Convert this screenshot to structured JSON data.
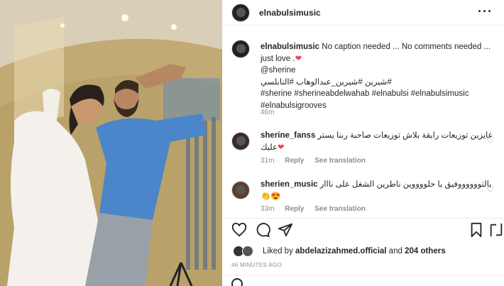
{
  "post": {
    "username": "elnabulsimusic",
    "more_icon": "more-horizontal-icon"
  },
  "caption": {
    "username": "elnabulsimusic",
    "text_line1": " No caption needed ... No comments needed ... just love .",
    "heart": "❤",
    "mention": "@sherine",
    "hashtags_ar": "#شيرين #شيرين_عبدالوهاب #النابلسي",
    "hashtags_en1": "#sherine #sherineabdelwahab #elnabulsi #elnabulsimusic",
    "hashtags_en2": "#elnabulsigrooves",
    "time": "46m"
  },
  "comments": [
    {
      "username": "sherine_fanss",
      "text": "عايزين توزيعات رايقة بلاش توزيعات صاحبة ربنا يستر عليك",
      "heart": "❤",
      "time": "31m",
      "reply": "Reply",
      "translate": "See translation"
    },
    {
      "username": "sherien_music",
      "text": "بالتووووووفيق يا حلووووين ناطرين الشغل على نااار",
      "emojis": "👏😍",
      "time": "33m",
      "reply": "Reply",
      "translate": "See translation"
    }
  ],
  "likes": {
    "prefix": "Liked by ",
    "user": "abdelazizahmed.official",
    "middle": " and ",
    "others": "204 others"
  },
  "timestamp": "46 MINUTES AGO",
  "colors": {
    "heart": "#ed4956",
    "text": "#262626",
    "muted": "#8e8e8e"
  }
}
